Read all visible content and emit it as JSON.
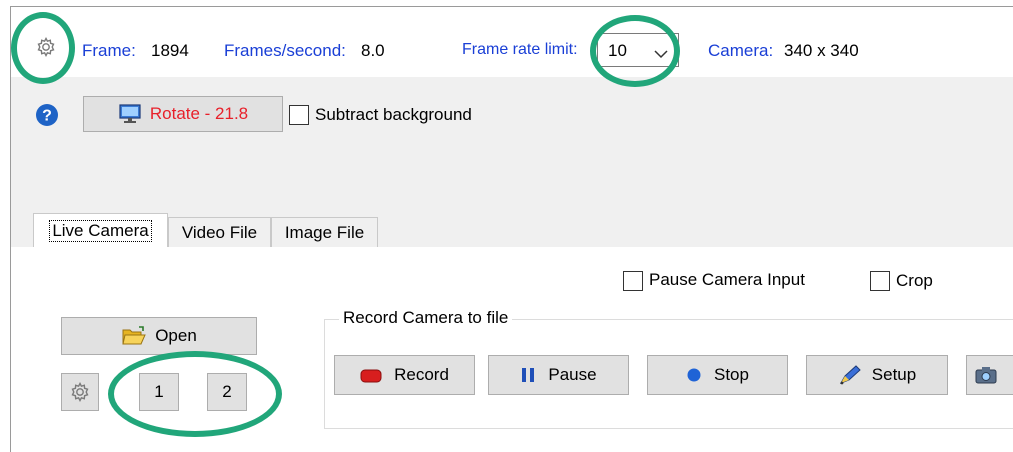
{
  "status_bar": {
    "frame_label": "Frame:",
    "frame_value": "1894",
    "fps_label": "Frames/second:",
    "fps_value": "8.0",
    "frame_rate_limit_label": "Frame rate limit:",
    "frame_rate_limit_value": "10",
    "camera_label": "Camera:",
    "camera_value": "340 x 340"
  },
  "toolbar": {
    "rotate_label": "Rotate - 21.8",
    "subtract_background_label": "Subtract background"
  },
  "tabs": [
    {
      "label": "Live Camera",
      "active": true
    },
    {
      "label": "Video File",
      "active": false
    },
    {
      "label": "Image File",
      "active": false
    }
  ],
  "live_camera": {
    "pause_camera_input_label": "Pause Camera Input",
    "crop_label": "Crop",
    "open_label": "Open",
    "camera_1_label": "1",
    "camera_2_label": "2",
    "record_group_title": "Record Camera to file",
    "record_label": "Record",
    "pause_label": "Pause",
    "stop_label": "Stop",
    "setup_label": "Setup"
  },
  "colors": {
    "status_blue": "#1a3fd6",
    "rotate_red": "#e8202a",
    "highlight_ring": "#21a67a",
    "panel_gray": "#f0f0f0"
  },
  "icons": [
    "gear-icon",
    "help-icon",
    "monitor-icon",
    "folder-open-icon",
    "record-icon",
    "pause-icon",
    "stop-icon",
    "setup-pen-icon",
    "camera-icon"
  ]
}
